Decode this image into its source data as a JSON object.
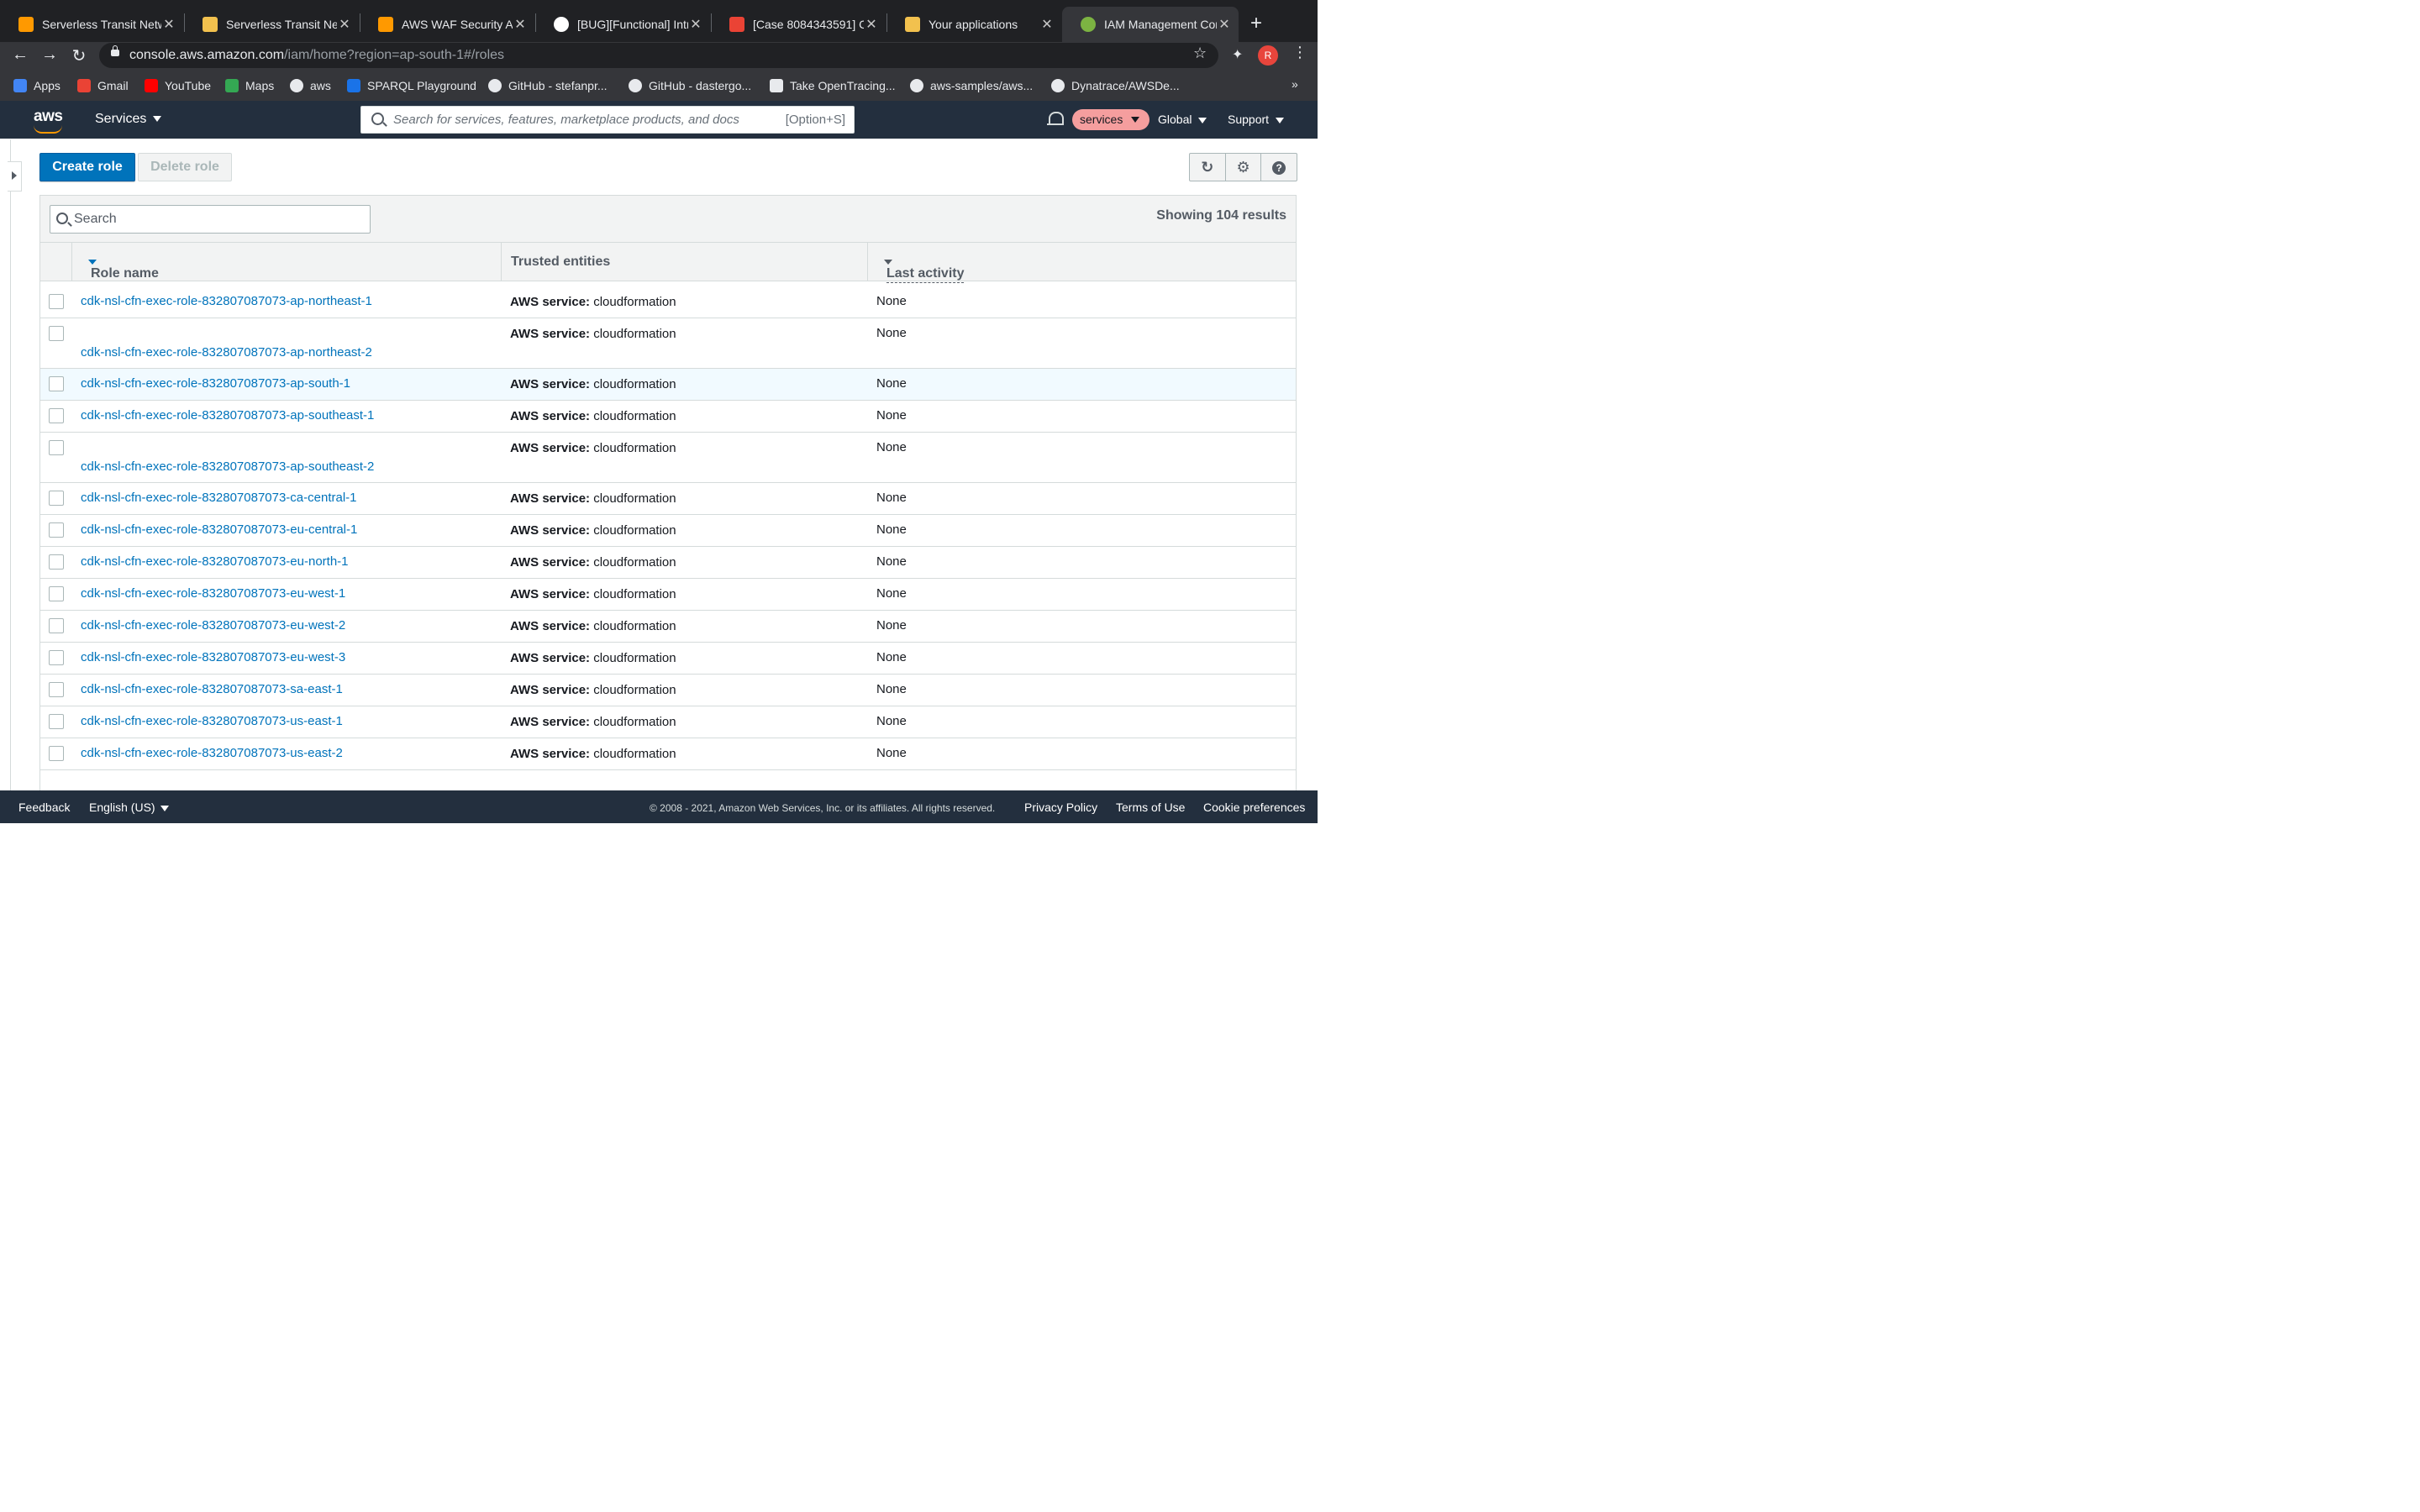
{
  "browser": {
    "tabs": [
      {
        "title": "Serverless Transit Netw",
        "color": "#ff9900"
      },
      {
        "title": "Serverless Transit Netw",
        "color": "#f2c14e"
      },
      {
        "title": "AWS WAF Security Aut",
        "color": "#ff9900"
      },
      {
        "title": "[BUG][Functional] Intro",
        "color": "#ffffff"
      },
      {
        "title": "[Case 8084343591] C",
        "color": "#ea4335"
      },
      {
        "title": "Your applications",
        "color": "#f2c14e"
      },
      {
        "title": "IAM Management Cons",
        "color": "#7cb342"
      }
    ],
    "url_host": "console.aws.amazon.com",
    "url_path": "/iam/home?region=ap-south-1#/roles",
    "avatar_letter": "R",
    "bookmarks": [
      {
        "label": "Apps",
        "color": "#4285f4"
      },
      {
        "label": "Gmail",
        "color": "#ea4335"
      },
      {
        "label": "YouTube",
        "color": "#ff0000"
      },
      {
        "label": "Maps",
        "color": "#34a853"
      },
      {
        "label": "aws",
        "color": "#e8eaed"
      },
      {
        "label": "SPARQL Playground",
        "color": "#1a73e8"
      },
      {
        "label": "GitHub - stefanpr...",
        "color": "#e8eaed"
      },
      {
        "label": "GitHub - dastergo...",
        "color": "#e8eaed"
      },
      {
        "label": "Take OpenTracing...",
        "color": "#e8eaed"
      },
      {
        "label": "aws-samples/aws...",
        "color": "#e8eaed"
      },
      {
        "label": "Dynatrace/AWSDe...",
        "color": "#e8eaed"
      }
    ],
    "bookmarks_more": "»"
  },
  "aws_header": {
    "logo": "aws",
    "services": "Services",
    "search_placeholder": "Search for services, features, marketplace products, and docs",
    "search_shortcut": "[Option+S]",
    "account_pill": "services",
    "region": "Global",
    "support": "Support"
  },
  "toolbar": {
    "create_role": "Create role",
    "delete_role": "Delete role"
  },
  "table": {
    "search_placeholder": "Search",
    "showing": "Showing 104 results",
    "columns": {
      "role_name": "Role name",
      "trusted_entities": "Trusted entities",
      "last_activity": "Last activity"
    },
    "rows": [
      {
        "name": "cdk-nsl-cfn-exec-role-832807087073-ap-northeast-1",
        "trust_label": "AWS service:",
        "trust_value": " cloudformation",
        "last": "None"
      },
      {
        "name": "cdk-nsl-cfn-exec-role-832807087073-ap-northeast-2",
        "trust_label": "AWS service:",
        "trust_value": " cloudformation",
        "last": "None"
      },
      {
        "name": "cdk-nsl-cfn-exec-role-832807087073-ap-south-1",
        "trust_label": "AWS service:",
        "trust_value": " cloudformation",
        "last": "None"
      },
      {
        "name": "cdk-nsl-cfn-exec-role-832807087073-ap-southeast-1",
        "trust_label": "AWS service:",
        "trust_value": " cloudformation",
        "last": "None"
      },
      {
        "name": "cdk-nsl-cfn-exec-role-832807087073-ap-southeast-2",
        "trust_label": "AWS service:",
        "trust_value": " cloudformation",
        "last": "None"
      },
      {
        "name": "cdk-nsl-cfn-exec-role-832807087073-ca-central-1",
        "trust_label": "AWS service:",
        "trust_value": " cloudformation",
        "last": "None"
      },
      {
        "name": "cdk-nsl-cfn-exec-role-832807087073-eu-central-1",
        "trust_label": "AWS service:",
        "trust_value": " cloudformation",
        "last": "None"
      },
      {
        "name": "cdk-nsl-cfn-exec-role-832807087073-eu-north-1",
        "trust_label": "AWS service:",
        "trust_value": " cloudformation",
        "last": "None"
      },
      {
        "name": "cdk-nsl-cfn-exec-role-832807087073-eu-west-1",
        "trust_label": "AWS service:",
        "trust_value": " cloudformation",
        "last": "None"
      },
      {
        "name": "cdk-nsl-cfn-exec-role-832807087073-eu-west-2",
        "trust_label": "AWS service:",
        "trust_value": " cloudformation",
        "last": "None"
      },
      {
        "name": "cdk-nsl-cfn-exec-role-832807087073-eu-west-3",
        "trust_label": "AWS service:",
        "trust_value": " cloudformation",
        "last": "None"
      },
      {
        "name": "cdk-nsl-cfn-exec-role-832807087073-sa-east-1",
        "trust_label": "AWS service:",
        "trust_value": " cloudformation",
        "last": "None"
      },
      {
        "name": "cdk-nsl-cfn-exec-role-832807087073-us-east-1",
        "trust_label": "AWS service:",
        "trust_value": " cloudformation",
        "last": "None"
      },
      {
        "name": "cdk-nsl-cfn-exec-role-832807087073-us-east-2",
        "trust_label": "AWS service:",
        "trust_value": " cloudformation",
        "last": "None"
      }
    ]
  },
  "footer": {
    "feedback": "Feedback",
    "language": "English (US)",
    "copyright": "© 2008 - 2021, Amazon Web Services, Inc. or its affiliates. All rights reserved.",
    "privacy": "Privacy Policy",
    "terms": "Terms of Use",
    "cookies": "Cookie preferences"
  }
}
